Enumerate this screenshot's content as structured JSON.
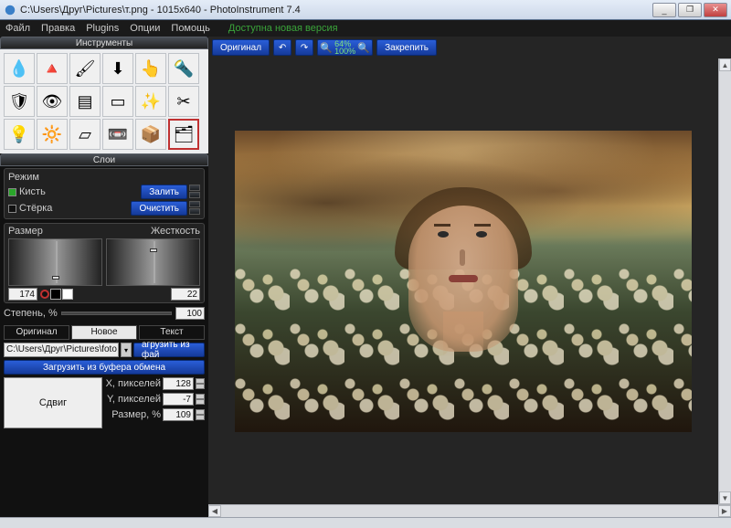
{
  "window": {
    "title": "C:\\Users\\Друг\\Pictures\\т.png - 1015x640 - PhotoInstrument 7.4",
    "min": "_",
    "max": "❐",
    "close": "✕"
  },
  "menu": {
    "file": "Файл",
    "edit": "Правка",
    "plugins": "Plugins",
    "options": "Опции",
    "help": "Помощь",
    "update": "Доступна новая версия"
  },
  "toolbar": {
    "original": "Оригинал",
    "undo": "↶",
    "redo": "↷",
    "zoom_out": "🔍",
    "zoom_top": "64%",
    "zoom_bottom": "100%",
    "zoom_in": "🔍",
    "pin": "Закрепить"
  },
  "panels": {
    "tools": "Инструменты",
    "layers": "Слои"
  },
  "tools": [
    {
      "name": "drop",
      "glyph": "💧"
    },
    {
      "name": "sharpen",
      "glyph": "🔺"
    },
    {
      "name": "brush",
      "glyph": "🖌"
    },
    {
      "name": "stamp",
      "glyph": "⬇"
    },
    {
      "name": "smudge",
      "glyph": "👆"
    },
    {
      "name": "dodge",
      "glyph": "🔦"
    },
    {
      "name": "shield",
      "glyph": "🛡"
    },
    {
      "name": "red-eye",
      "glyph": "👁"
    },
    {
      "name": "levels",
      "glyph": "▤"
    },
    {
      "name": "hue",
      "glyph": "▭"
    },
    {
      "name": "heal",
      "glyph": "✨"
    },
    {
      "name": "cut",
      "glyph": "✂"
    },
    {
      "name": "light",
      "glyph": "💡"
    },
    {
      "name": "bulb",
      "glyph": "🔆"
    },
    {
      "name": "eraser",
      "glyph": "▱"
    },
    {
      "name": "tape",
      "glyph": "📼"
    },
    {
      "name": "box",
      "glyph": "📦"
    },
    {
      "name": "layers-tool",
      "glyph": "🗂"
    }
  ],
  "mode": {
    "label": "Режим",
    "brush": "Кисть",
    "eraser": "Стёрка",
    "fill": "Залить",
    "clear": "Очистить"
  },
  "sliders": {
    "size_label": "Размер",
    "hard_label": "Жесткость",
    "size": "174",
    "hard": "22"
  },
  "degree": {
    "label": "Степень, %",
    "value": "100"
  },
  "tabs": {
    "original": "Оригинал",
    "newimg": "Новое изображение",
    "text": "Текст"
  },
  "file": {
    "path": "C:\\Users\\Друг\\Pictures\\foto na ",
    "load_file": "агрузить из фай",
    "load_clip": "Загрузить из буфера обмена"
  },
  "offset": {
    "shift": "Сдвиг",
    "x_label": "X, пикселей",
    "y_label": "Y, пикселей",
    "size_label": "Размер, %",
    "x": "128",
    "y": "-7",
    "size": "109"
  }
}
